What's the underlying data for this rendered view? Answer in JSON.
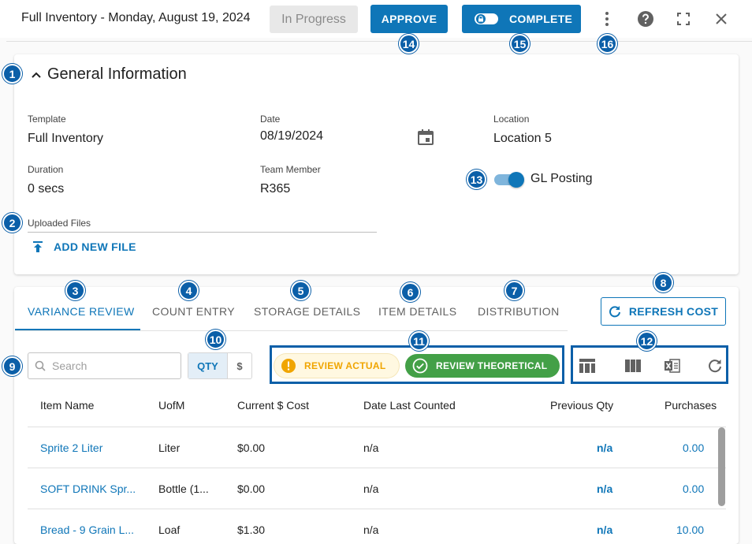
{
  "header": {
    "title": "Full Inventory - Monday, August 19, 2024",
    "status": "In Progress",
    "approve_label": "APPROVE",
    "complete_label": "COMPLETE",
    "icons": [
      "more-vert-icon",
      "help-icon",
      "fullscreen-icon",
      "close-icon"
    ]
  },
  "general": {
    "title": "General Information",
    "template_label": "Template",
    "template_value": "Full Inventory",
    "date_label": "Date",
    "date_value": "08/19/2024",
    "location_label": "Location",
    "location_value": "Location 5",
    "duration_label": "Duration",
    "duration_value": "0 secs",
    "team_member_label": "Team Member",
    "team_member_value": "R365",
    "gl_posting_label": "GL Posting",
    "gl_posting_enabled": true,
    "uploaded_files_label": "Uploaded Files",
    "add_file_label": "ADD NEW FILE"
  },
  "tabs": [
    {
      "label": "VARIANCE REVIEW",
      "active": true
    },
    {
      "label": "COUNT ENTRY",
      "active": false
    },
    {
      "label": "STORAGE DETAILS",
      "active": false
    },
    {
      "label": "ITEM DETAILS",
      "active": false
    },
    {
      "label": "DISTRIBUTION",
      "active": false
    }
  ],
  "refresh_label": "REFRESH COST",
  "search": {
    "placeholder": "Search",
    "value": ""
  },
  "unit_toggle": {
    "qty": "QTY",
    "usd": "$",
    "selected": "QTY"
  },
  "review": {
    "actual": "REVIEW ACTUAL",
    "theoretical": "REVIEW THEORETICAL"
  },
  "toolbar_icons": [
    "table-view-icon",
    "columns-icon",
    "excel-export-icon",
    "refresh-icon"
  ],
  "table": {
    "headers": [
      "Item Name",
      "UofM",
      "Current $ Cost",
      "Date Last Counted",
      "Previous Qty",
      "Purchases"
    ],
    "rows": [
      {
        "item": "Sprite 2 Liter",
        "uofm": "Liter",
        "cost": "$0.00",
        "date": "n/a",
        "prev_qty": "n/a",
        "purchases": "0.00"
      },
      {
        "item": "SOFT DRINK Spr...",
        "uofm": "Bottle (1...",
        "cost": "$0.00",
        "date": "n/a",
        "prev_qty": "n/a",
        "purchases": "0.00"
      },
      {
        "item": "Bread - 9 Grain L...",
        "uofm": "Loaf",
        "cost": "$1.30",
        "date": "n/a",
        "prev_qty": "n/a",
        "purchases": "10.00"
      }
    ]
  },
  "badges": [
    "1",
    "2",
    "3",
    "4",
    "5",
    "6",
    "7",
    "8",
    "9",
    "10",
    "11",
    "12",
    "13",
    "14",
    "15",
    "16"
  ],
  "colors": {
    "primary": "#0f76b8",
    "badge": "#0b5fa8",
    "success": "#43a047",
    "warning": "#f0a500"
  }
}
